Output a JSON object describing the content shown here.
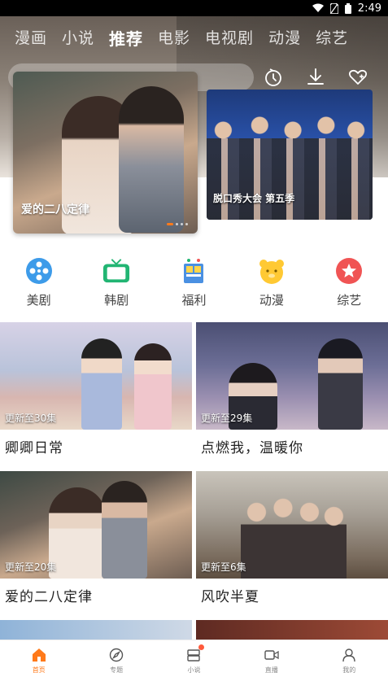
{
  "status_bar": {
    "time": "2:49"
  },
  "top_nav": {
    "tabs": [
      {
        "label": "漫画",
        "active": false
      },
      {
        "label": "小说",
        "active": false
      },
      {
        "label": "推荐",
        "active": true
      },
      {
        "label": "电影",
        "active": false
      },
      {
        "label": "电视剧",
        "active": false
      },
      {
        "label": "动漫",
        "active": false
      },
      {
        "label": "综艺",
        "active": false
      }
    ]
  },
  "header_icons": [
    "history-icon",
    "download-icon",
    "favorite-icon"
  ],
  "banners": {
    "main": {
      "title": "爱的二八定律"
    },
    "side": {
      "title": "脱口秀大会 第五季"
    }
  },
  "categories": [
    {
      "label": "美剧",
      "icon": "film-reel-icon",
      "color": "#3d9be9"
    },
    {
      "label": "韩剧",
      "icon": "tv-icon",
      "color": "#22b573"
    },
    {
      "label": "福利",
      "icon": "gift-book-icon",
      "color": "#4a90e2"
    },
    {
      "label": "动漫",
      "icon": "bear-icon",
      "color": "#ffc933"
    },
    {
      "label": "综艺",
      "icon": "star-badge-icon",
      "color": "#f05454"
    }
  ],
  "shows": [
    {
      "title": "卿卿日常",
      "badge": "更新至30集"
    },
    {
      "title": "点燃我，温暖你",
      "badge": "更新至29集"
    },
    {
      "title": "爱的二八定律",
      "badge": "更新至20集"
    },
    {
      "title": "风吹半夏",
      "badge": "更新至6集"
    }
  ],
  "bottom_nav": [
    {
      "label": "首页",
      "icon": "home-icon",
      "active": true
    },
    {
      "label": "专题",
      "icon": "compass-icon",
      "active": false
    },
    {
      "label": "小说",
      "icon": "book-icon",
      "active": false,
      "dot": true
    },
    {
      "label": "直播",
      "icon": "video-camera-icon",
      "active": false
    },
    {
      "label": "我的",
      "icon": "user-icon",
      "active": false
    }
  ],
  "colors": {
    "accent": "#ff7a1a"
  }
}
